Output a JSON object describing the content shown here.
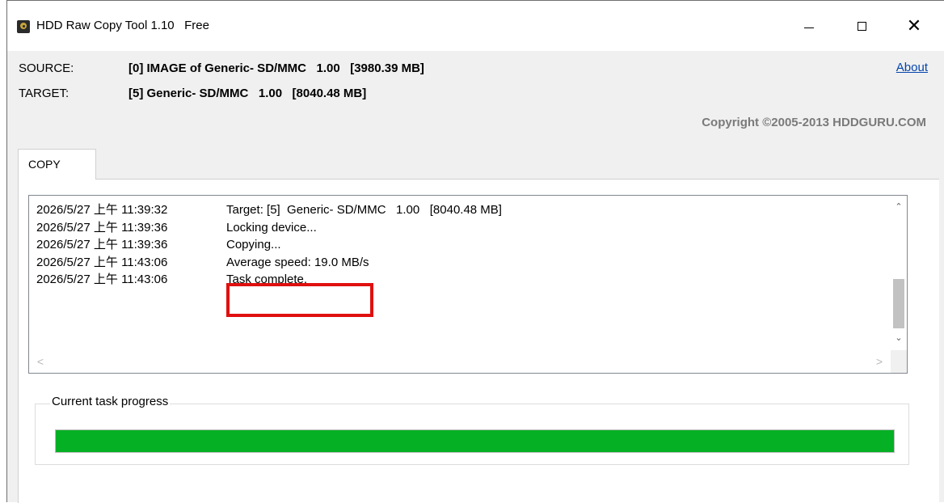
{
  "window": {
    "title": "HDD Raw Copy Tool 1.10   Free",
    "icons": {
      "app": "hdd-app-icon",
      "minimize": "minimize-icon",
      "maximize": "maximize-icon",
      "close": "close-icon"
    }
  },
  "header": {
    "source_label": "SOURCE:",
    "source_value": "[0] IMAGE of Generic- SD/MMC   1.00   [3980.39 MB]",
    "target_label": "TARGET:",
    "target_value": "[5] Generic- SD/MMC   1.00   [8040.48 MB]",
    "about_link": "About",
    "copyright": "Copyright ©2005-2013 HDDGURU.COM"
  },
  "tabs": [
    {
      "label": "COPY"
    }
  ],
  "log": {
    "lines": [
      {
        "timestamp": "2026/5/27 上午 11:39:32",
        "message": "Target: [5]  Generic- SD/MMC   1.00   [8040.48 MB]"
      },
      {
        "timestamp": "2026/5/27 上午 11:39:36",
        "message": "Locking device..."
      },
      {
        "timestamp": "2026/5/27 上午 11:39:36",
        "message": "Copying..."
      },
      {
        "timestamp": "2026/5/27 上午 11:43:06",
        "message": "Average speed: 19.0 MB/s"
      },
      {
        "timestamp": "2026/5/27 上午 11:43:06",
        "message": "Task complete."
      }
    ]
  },
  "scroll": {
    "up": "⌃",
    "down": "⌄",
    "left": "<",
    "right": ">"
  },
  "progress": {
    "label": "Current task progress",
    "fraction": 1.0,
    "fill_color": "#06b025"
  },
  "colors": {
    "highlight": "#e01010",
    "link": "#0645ad"
  }
}
